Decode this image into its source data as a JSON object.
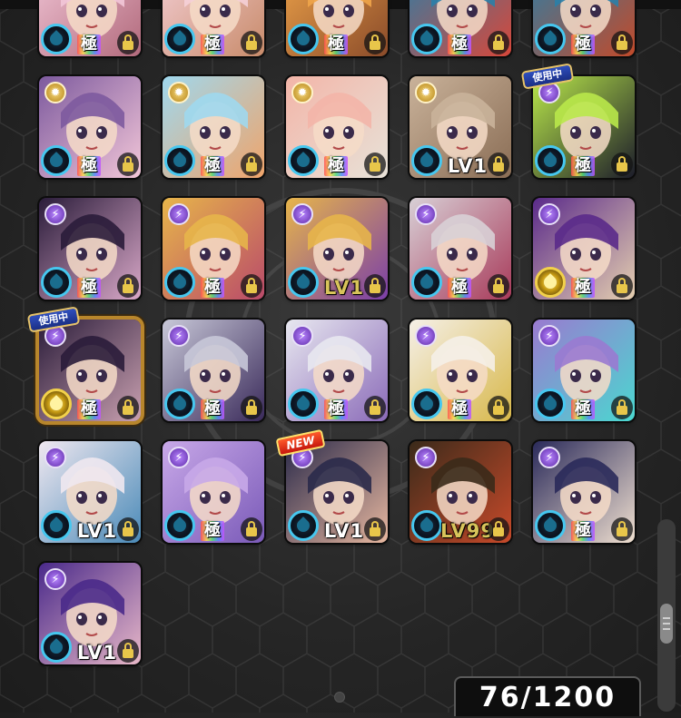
{
  "badges": {
    "in_use": "使用中",
    "new": "NEW",
    "kiwame": "極"
  },
  "counter": "76/1200",
  "rows": [
    [
      {
        "element": "water",
        "evo": "極",
        "lock": true,
        "colors": [
          "#f2c7d8",
          "#b26a7c"
        ],
        "partial": true
      },
      {
        "element": "water",
        "evo": "極",
        "lock": true,
        "colors": [
          "#f5d0d8",
          "#c88b6a"
        ],
        "partial": true
      },
      {
        "element": "water",
        "evo": "極",
        "lock": true,
        "colors": [
          "#f0a54a",
          "#8a4b2a"
        ],
        "partial": true
      },
      {
        "element": "water",
        "evo": "極",
        "lock": true,
        "colors": [
          "#2a7fa8",
          "#d8473a"
        ],
        "partial": true
      },
      {
        "element": "water",
        "evo": "極",
        "lock": true,
        "colors": [
          "#2a7fa8",
          "#c24a2a"
        ],
        "partial": true
      }
    ],
    [
      {
        "element": "light",
        "evo": "極",
        "lock": true,
        "colors": [
          "#7d5a9e",
          "#f2c6d8"
        ]
      },
      {
        "element": "light",
        "evo": "極",
        "lock": true,
        "colors": [
          "#9fd8ee",
          "#f0a46a"
        ]
      },
      {
        "element": "light",
        "evo": "極",
        "lock": true,
        "colors": [
          "#f3b5a8",
          "#e7e2d8"
        ]
      },
      {
        "element": "light",
        "level": "LV1",
        "lock": true,
        "colors": [
          "#c9b29a",
          "#8a6d55"
        ]
      },
      {
        "element": "dark",
        "evo": "極",
        "lock": true,
        "colors": [
          "#b9e84a",
          "#1c1c2a"
        ],
        "in_use": true
      }
    ],
    [
      {
        "element": "dark",
        "evo": "極",
        "lock": true,
        "colors": [
          "#2a1c3a",
          "#d9a8c8"
        ]
      },
      {
        "element": "dark",
        "evo": "極",
        "lock": true,
        "colors": [
          "#e7b54a",
          "#b94a6a"
        ]
      },
      {
        "element": "dark",
        "level": "LV1",
        "lock": true,
        "colors": [
          "#e7b54a",
          "#7a3ea8"
        ],
        "gold_level": true
      },
      {
        "element": "dark",
        "evo": "極",
        "lock": true,
        "colors": [
          "#d8d0d6",
          "#a83a5a"
        ]
      },
      {
        "element": "dark",
        "evo": "極",
        "lock": true,
        "colors": [
          "#5a2a8a",
          "#e6d0b0"
        ],
        "gold_orb": true
      }
    ],
    [
      {
        "element": "dark",
        "evo": "極",
        "lock": true,
        "colors": [
          "#2a1c3a",
          "#c9a0b0"
        ],
        "gold_orb": true,
        "frame": true,
        "in_use": true
      },
      {
        "element": "dark",
        "evo": "極",
        "lock": true,
        "colors": [
          "#c8c8d8",
          "#3a2a5a"
        ]
      },
      {
        "element": "dark",
        "evo": "極",
        "lock": true,
        "colors": [
          "#e8e8f0",
          "#8a6ab8"
        ]
      },
      {
        "element": "dark",
        "evo": "極",
        "lock": true,
        "colors": [
          "#f5f0e8",
          "#d8b84a"
        ]
      },
      {
        "element": "dark",
        "evo": "極",
        "lock": true,
        "colors": [
          "#9a7ad0",
          "#4ad8d0"
        ]
      }
    ],
    [
      {
        "element": "dark",
        "level": "LV1",
        "lock": true,
        "colors": [
          "#f0e8f0",
          "#4a8ab8"
        ]
      },
      {
        "element": "dark",
        "evo": "極",
        "lock": true,
        "colors": [
          "#c8a8e8",
          "#7a5ab8"
        ]
      },
      {
        "element": "dark",
        "level": "LV1",
        "lock": true,
        "colors": [
          "#2a2a4a",
          "#e8b8a0"
        ],
        "is_new": true
      },
      {
        "element": "dark",
        "level": "LV99",
        "lock": true,
        "colors": [
          "#3a2a1a",
          "#c84a2a"
        ],
        "gold_level": true
      },
      {
        "element": "dark",
        "evo": "極",
        "lock": true,
        "colors": [
          "#2a2a5a",
          "#f0e0d0"
        ]
      }
    ],
    [
      {
        "element": "dark",
        "level": "LV1",
        "lock": true,
        "colors": [
          "#4a2a8a",
          "#e8b8c8"
        ]
      }
    ]
  ]
}
